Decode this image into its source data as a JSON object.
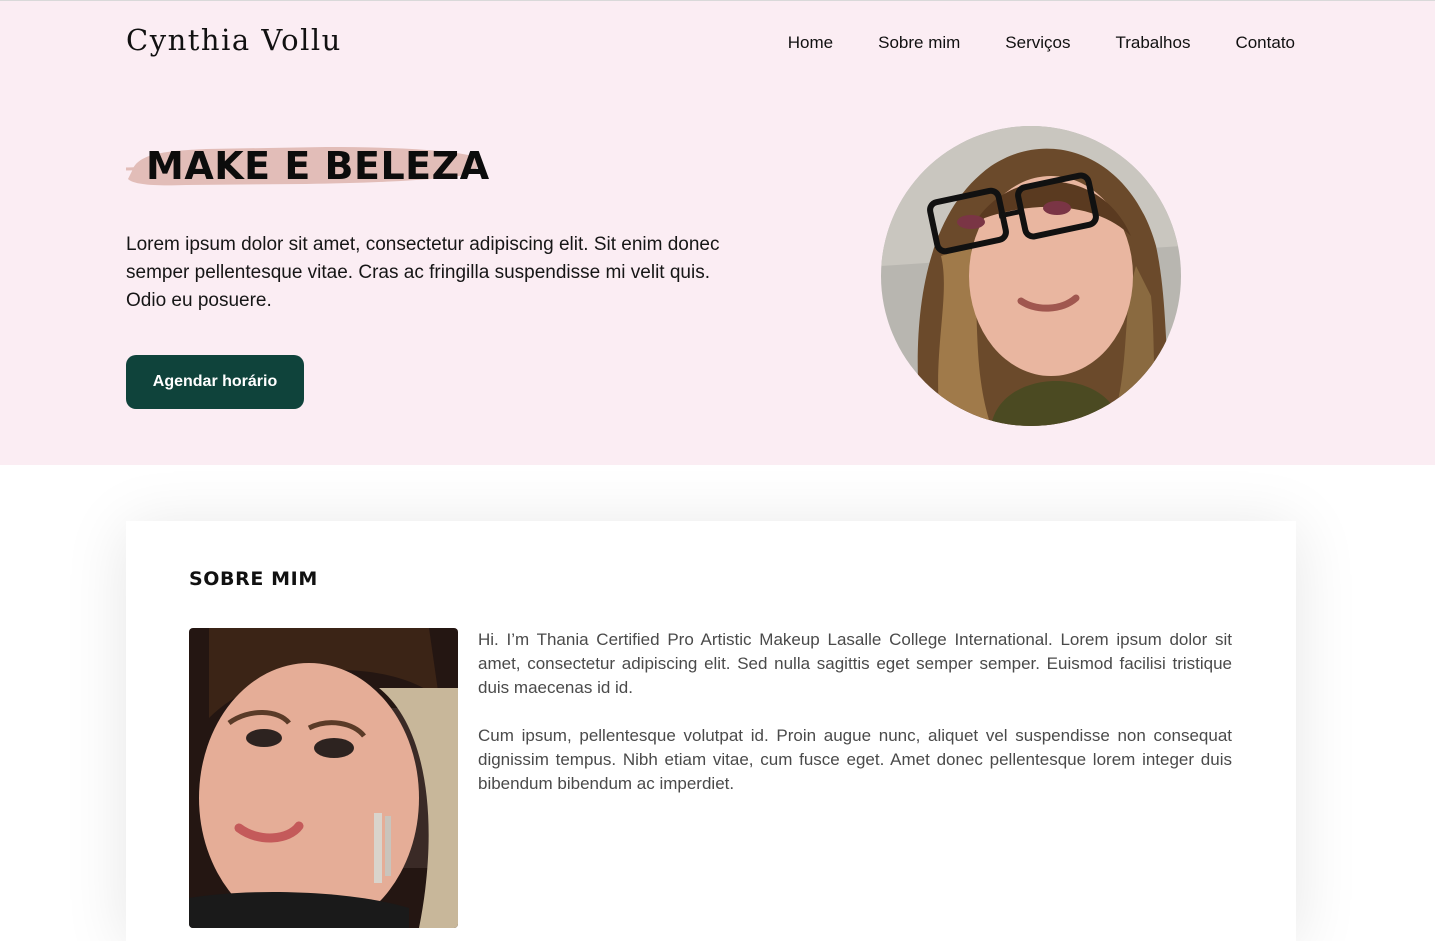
{
  "header": {
    "logo": "Cynthia Vollu",
    "nav": [
      "Home",
      "Sobre mim",
      "Serviços",
      "Trabalhos",
      "Contato"
    ]
  },
  "hero": {
    "headline": "MAKE E BELEZA",
    "text": "Lorem ipsum dolor sit amet, consectetur adipiscing elit. Sit enim donec semper pellentesque vitae. Cras ac fringilla suspendisse mi velit quis. Odio eu posuere.",
    "cta_label": "Agendar horário"
  },
  "about": {
    "title": "SOBRE MIM",
    "paragraphs": [
      "Hi. I’m Thania Certified Pro Artistic Makeup Lasalle College International. Lorem ipsum dolor sit amet, consectetur adipiscing elit. Sed nulla sagittis eget semper semper. Euismod facilisi tristique duis maecenas id id.",
      "Cum ipsum, pellentesque volutpat id. Proin augue nunc, aliquet vel suspendisse non consequat dignissim tempus. Nibh etiam vitae, cum fusce eget. Amet donec pellentesque lorem integer duis bibendum bibendum ac imperdiet."
    ]
  },
  "colors": {
    "hero_bg": "#fbedf3",
    "brush": "#e2bdb8",
    "cta_bg": "#0f433b",
    "text_muted": "#4a4a4a"
  }
}
